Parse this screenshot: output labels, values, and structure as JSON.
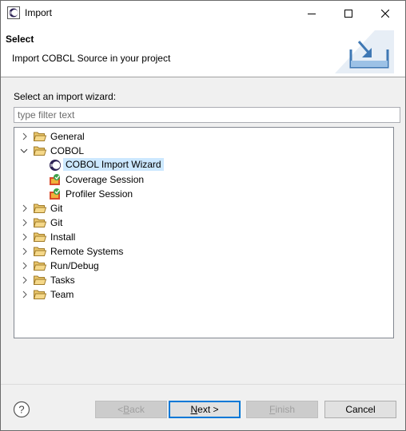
{
  "window": {
    "title": "Import"
  },
  "banner": {
    "title": "Select",
    "description": "Import COBCL Source in your project"
  },
  "main": {
    "wizard_label": "Select an import wizard:",
    "filter_placeholder": "type filter text",
    "tree": [
      {
        "label": "General",
        "expanded": false
      },
      {
        "label": "COBOL",
        "expanded": true,
        "children": [
          {
            "label": "COBOL Import Wizard",
            "icon": "cobol-wizard-icon",
            "selected": true
          },
          {
            "label": "Coverage Session",
            "icon": "coverage-session-icon"
          },
          {
            "label": "Profiler Session",
            "icon": "profiler-session-icon"
          }
        ]
      },
      {
        "label": "Git",
        "expanded": false
      },
      {
        "label": "Git",
        "expanded": false
      },
      {
        "label": "Install",
        "expanded": false
      },
      {
        "label": "Remote Systems",
        "expanded": false
      },
      {
        "label": "Run/Debug",
        "expanded": false
      },
      {
        "label": "Tasks",
        "expanded": false
      },
      {
        "label": "Team",
        "expanded": false
      }
    ]
  },
  "footer": {
    "back": {
      "pre": "< ",
      "key": "B",
      "rest": "ack",
      "enabled": false
    },
    "next": {
      "key": "N",
      "rest": "ext >",
      "enabled": true
    },
    "finish": {
      "key": "F",
      "rest": "inish",
      "enabled": false
    },
    "cancel": {
      "label": "Cancel",
      "enabled": true
    }
  },
  "colors": {
    "selection": "#cce8ff",
    "folder": "#e8c56a",
    "default_button_border": "#0078d7"
  }
}
